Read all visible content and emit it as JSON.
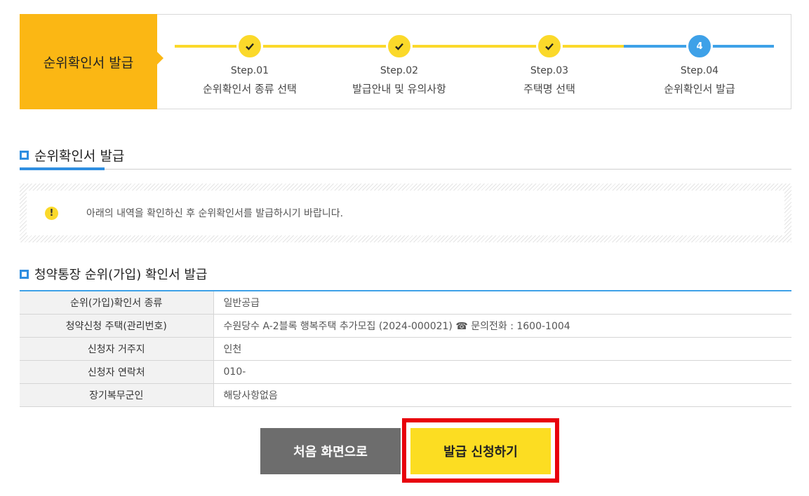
{
  "stepper": {
    "title": "순위확인서 발급",
    "steps": [
      {
        "num": "Step.01",
        "label": "순위확인서 종류 선택",
        "status": "done"
      },
      {
        "num": "Step.02",
        "label": "발급안내 및 유의사항",
        "status": "done"
      },
      {
        "num": "Step.03",
        "label": "주택명 선택",
        "status": "done"
      },
      {
        "num": "Step.04",
        "label": "순위확인서 발급",
        "status": "current",
        "badge": "4"
      }
    ]
  },
  "section1": {
    "title": "순위확인서 발급"
  },
  "notice": {
    "text": "아래의 내역을 확인하신 후 순위확인서를 발급하시기 바랍니다.",
    "icon": "!"
  },
  "section2": {
    "title": "청약통장 순위(가입) 확인서 발급"
  },
  "table": {
    "rows": [
      {
        "label": "순위(가입)확인서 종류",
        "value": "일반공급"
      },
      {
        "label": "청약신청 주택(관리번호)",
        "value": "수원당수 A-2블록 행복주택 추가모집 (2024-000021) ☎ 문의전화 : 1600-1004"
      },
      {
        "label": "신청자 거주지",
        "value": "인천"
      },
      {
        "label": "신청자 연락처",
        "value": "010-"
      },
      {
        "label": "장기복무군인",
        "value": "해당사항없음"
      }
    ]
  },
  "buttons": {
    "home": "처음 화면으로",
    "apply": "발급 신청하기"
  },
  "colors": {
    "accent_yellow": "#fbd92a",
    "accent_blue": "#3ea1e8",
    "title_orange": "#fbb714",
    "highlight_red": "#e8000b"
  }
}
